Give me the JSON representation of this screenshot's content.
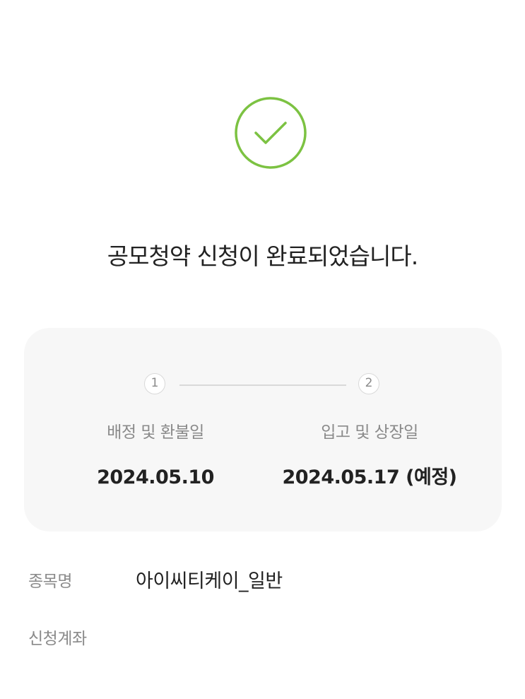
{
  "icon": {
    "name": "check-circle-icon",
    "color": "#7cc242"
  },
  "title": "공모청약 신청이 완료되었습니다.",
  "schedule": {
    "steps": [
      {
        "number": "1",
        "label": "배정 및 환불일",
        "date": "2024.05.10"
      },
      {
        "number": "2",
        "label": "입고 및 상장일",
        "date": "2024.05.17 (예정)"
      }
    ]
  },
  "details": {
    "stock_label": "종목명",
    "stock_value": "아이씨티케이_일반",
    "account_label": "신청계좌",
    "account_value": ""
  }
}
